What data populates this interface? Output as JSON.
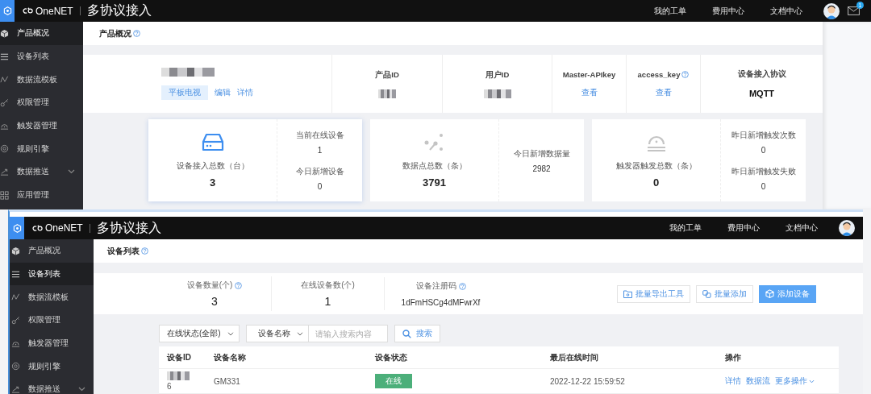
{
  "back_window": {
    "kind": "overview",
    "topbar": {
      "brand": "OneNET",
      "product": "多协议接入",
      "links": [
        "我的工单",
        "费用中心",
        "文档中心"
      ],
      "mail_badge": "1"
    },
    "sidebar": [
      {
        "label": "产品概况",
        "selected": true,
        "expandable": false
      },
      {
        "label": "设备列表",
        "selected": false,
        "expandable": false
      },
      {
        "label": "数据流模板",
        "selected": false,
        "expandable": false
      },
      {
        "label": "权限管理",
        "selected": false,
        "expandable": false
      },
      {
        "label": "触发器管理",
        "selected": false,
        "expandable": false
      },
      {
        "label": "规则引擎",
        "selected": false,
        "expandable": false
      },
      {
        "label": "数据推送",
        "selected": false,
        "expandable": true
      },
      {
        "label": "应用管理",
        "selected": false,
        "expandable": false
      }
    ],
    "page": {
      "title": "产品概况",
      "title_help": true,
      "product": {
        "tag": "平板电视",
        "links": [
          "编辑",
          "详情"
        ]
      },
      "info_columns": [
        {
          "label": "产品ID",
          "help": false,
          "kind": "blurred"
        },
        {
          "label": "用户ID",
          "help": false,
          "kind": "blurred"
        },
        {
          "label": "Master-APIkey",
          "help": false,
          "kind": "link",
          "value": "查看"
        },
        {
          "label": "access_key",
          "help": true,
          "kind": "link",
          "value": "查看"
        },
        {
          "label": "设备接入协议",
          "help": false,
          "kind": "text",
          "value": "MQTT"
        }
      ],
      "stat_cards": [
        {
          "selected": true,
          "label": "设备接入总数（台）",
          "value": "3",
          "side": [
            {
              "label": "当前在线设备",
              "value": "1"
            },
            {
              "label": "今日新增设备",
              "value": "0"
            }
          ]
        },
        {
          "selected": false,
          "label": "数据点总数（条）",
          "value": "3791",
          "side": [
            {
              "label": "今日新增数据量",
              "value": "2982"
            }
          ]
        },
        {
          "selected": false,
          "label": "触发器触发总数（条）",
          "value": "0",
          "side": [
            {
              "label": "昨日新增触发次数",
              "value": "0"
            },
            {
              "label": "昨日新增触发失败",
              "value": "0"
            }
          ]
        }
      ]
    }
  },
  "front_window": {
    "kind": "device_list",
    "topbar": {
      "brand": "OneNET",
      "product": "多协议接入",
      "links": [
        "我的工单",
        "费用中心",
        "文档中心"
      ]
    },
    "sidebar": [
      {
        "label": "产品概况",
        "selected": false,
        "expandable": false
      },
      {
        "label": "设备列表",
        "selected": true,
        "expandable": false
      },
      {
        "label": "数据流模板",
        "selected": false,
        "expandable": false
      },
      {
        "label": "权限管理",
        "selected": false,
        "expandable": false
      },
      {
        "label": "触发器管理",
        "selected": false,
        "expandable": false
      },
      {
        "label": "规则引擎",
        "selected": false,
        "expandable": false
      },
      {
        "label": "数据推送",
        "selected": false,
        "expandable": true
      }
    ],
    "page": {
      "title": "设备列表",
      "title_help": true,
      "stats": [
        {
          "label": "设备数量(个)",
          "help": true,
          "value": "3"
        },
        {
          "label": "在线设备数(个)",
          "help": false,
          "value": "1"
        },
        {
          "label": "设备注册码",
          "help": true,
          "value": "1dFmHSCg4dMFwrXf"
        }
      ],
      "actions": [
        {
          "label": "批量导出工具",
          "kind": "outline"
        },
        {
          "label": "批量添加",
          "kind": "outline"
        },
        {
          "label": "添加设备",
          "kind": "primary"
        }
      ],
      "filters": {
        "status": "在线状态(全部)",
        "field": "设备名称",
        "placeholder": "请输入搜索内容",
        "search": "搜索"
      },
      "table": {
        "columns": [
          "设备ID",
          "设备名称",
          "设备状态",
          "最后在线时间",
          "操作"
        ],
        "rows": [
          {
            "device_id": "6",
            "name": "GM331",
            "status": "在线",
            "online": true,
            "last_online": "2022-12-22 15:59:52",
            "actions": [
              "详情",
              "数据流",
              "更多操作"
            ]
          }
        ]
      }
    }
  }
}
